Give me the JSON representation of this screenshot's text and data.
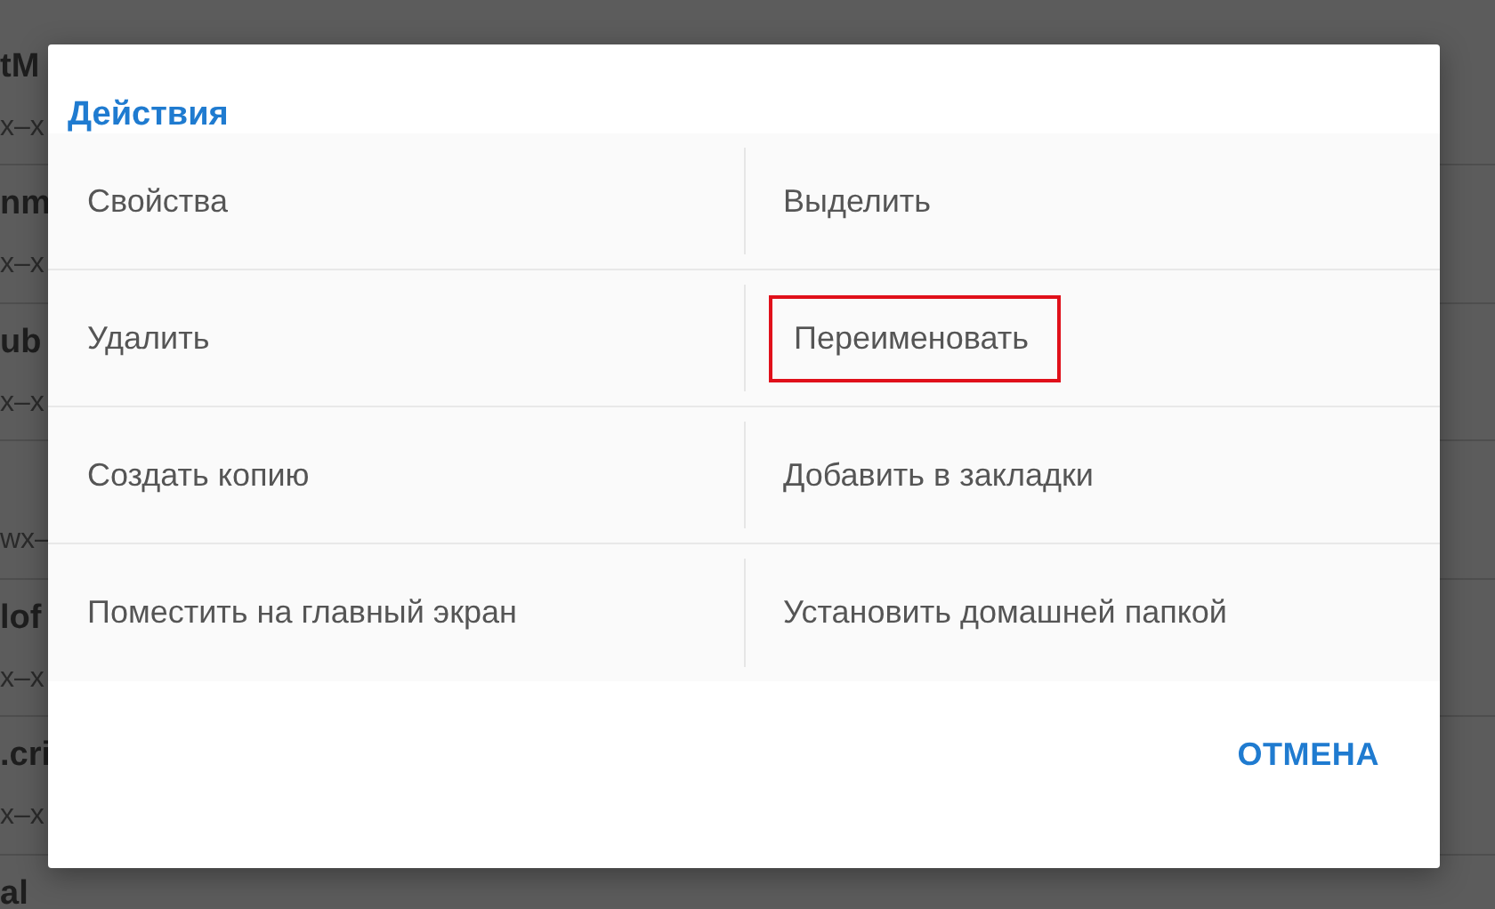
{
  "background_list": [
    {
      "title": "tM",
      "subtitle": "x–x"
    },
    {
      "title": "nm",
      "subtitle": "x–x"
    },
    {
      "title": "ub",
      "subtitle": "x–x"
    },
    {
      "subtitle": "wx–"
    },
    {
      "title": "lof",
      "subtitle": "x–x"
    },
    {
      "title": ".cri",
      "subtitle": "x–x"
    },
    {
      "title": "al"
    }
  ],
  "dialog": {
    "title": "Действия",
    "actions": [
      {
        "label": "Свойства",
        "highlighted": false
      },
      {
        "label": "Выделить",
        "highlighted": false
      },
      {
        "label": "Удалить",
        "highlighted": false
      },
      {
        "label": "Переименовать",
        "highlighted": true
      },
      {
        "label": "Создать копию",
        "highlighted": false
      },
      {
        "label": "Добавить в закладки",
        "highlighted": false
      },
      {
        "label": "Поместить на главный экран",
        "highlighted": false
      },
      {
        "label": "Установить домашней папкой",
        "highlighted": false
      }
    ],
    "buttons": [
      "ОТМЕНА"
    ]
  }
}
